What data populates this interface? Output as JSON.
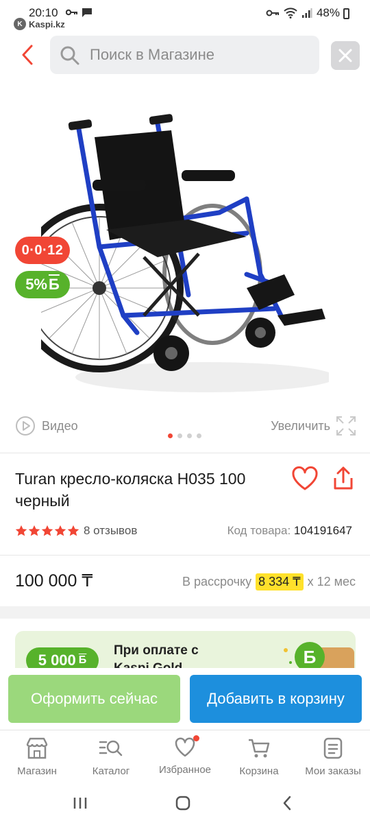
{
  "status_bar": {
    "time": "20:10",
    "app_name": "Kaspi.kz",
    "battery": "48%",
    "icons": [
      "key-icon",
      "wifi-icon",
      "signal-icon",
      "battery-icon",
      "notification-icon"
    ]
  },
  "header": {
    "search_placeholder": "Поиск в Магазине"
  },
  "badges": {
    "credit": "0·0·12",
    "bonus_percent": "5%",
    "bonus_symbol": "Б"
  },
  "media": {
    "video_label": "Видео",
    "zoom_label": "Увеличить",
    "slides_total": 4,
    "slide_active": 1
  },
  "product": {
    "title": "Turan кресло-коляска H035 100 черный",
    "rating": 5,
    "reviews": "8 отзывов",
    "sku_label": "Код товара:",
    "sku_value": "104191647",
    "price": "100 000 ₸",
    "installment_label": "В рассрочку",
    "installment_amount": "8 334 ₸",
    "installment_term": "х 12 мес"
  },
  "promo": {
    "badge": "5 000",
    "badge_symbol": "Б",
    "text_line1": "При оплате с",
    "text_line2": "Kaspi Gold"
  },
  "actions": {
    "checkout": "Оформить сейчас",
    "add_to_cart": "Добавить в корзину"
  },
  "tabs": [
    {
      "label": "Магазин",
      "icon": "shop-icon"
    },
    {
      "label": "Каталог",
      "icon": "catalog-icon"
    },
    {
      "label": "Избранное",
      "icon": "heart-icon"
    },
    {
      "label": "Корзина",
      "icon": "cart-icon"
    },
    {
      "label": "Мои заказы",
      "icon": "orders-icon"
    }
  ],
  "colors": {
    "accent_red": "#f14635",
    "bonus_green": "#57b22b",
    "cart_blue": "#1d8fdd",
    "checkout_green": "#9bd87c",
    "installment_yellow": "#ffe12b",
    "chair_frame_blue": "#1f3fc4"
  }
}
